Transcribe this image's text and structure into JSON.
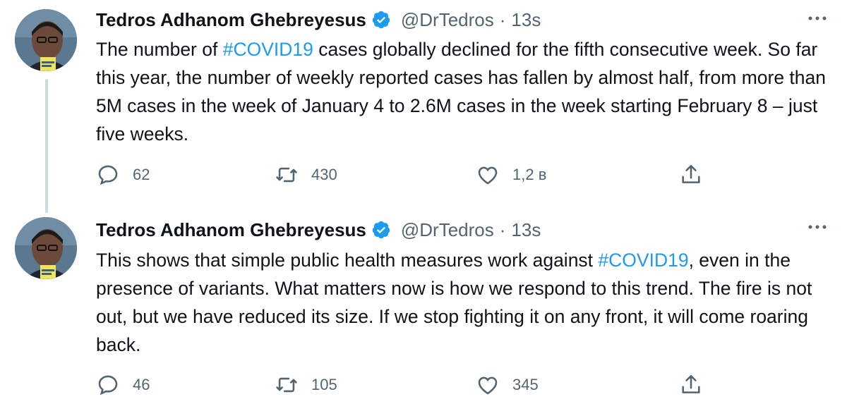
{
  "tweets": [
    {
      "author_name": "Tedros Adhanom Ghebreyesus",
      "handle": "@DrTedros",
      "separator": "·",
      "time": "13s",
      "text_parts": {
        "p1": "The number of ",
        "hashtag": "#COVID19",
        "p2": " cases globally declined for the fifth consecutive week. So far this year, the number of weekly reported cases has fallen by almost half, from more than 5M cases in the week of January 4 to 2.6M cases in the week starting February 8 – just five weeks."
      },
      "replies": "62",
      "retweets": "430",
      "likes": "1,2 в",
      "icons": {
        "reply": "speech-bubble-icon",
        "retweet": "retweet-icon",
        "like": "heart-icon",
        "share": "share-icon",
        "more": "more-icon",
        "verified": "verified-badge-icon"
      }
    },
    {
      "author_name": "Tedros Adhanom Ghebreyesus",
      "handle": "@DrTedros",
      "separator": "·",
      "time": "13s",
      "text_parts": {
        "p1": "This shows that simple public health measures work against ",
        "hashtag": "#COVID19",
        "p2": ", even in the presence of variants. What matters now is how we respond to this trend. The fire is not out, but we have reduced its size. If we stop fighting it on any front, it will come roaring back."
      },
      "replies": "46",
      "retweets": "105",
      "likes": "345",
      "icons": {
        "reply": "speech-bubble-icon",
        "retweet": "retweet-icon",
        "like": "heart-icon",
        "share": "share-icon",
        "more": "more-icon",
        "verified": "verified-badge-icon"
      }
    }
  ],
  "colors": {
    "hashtag": "#1d9bf0",
    "verified": "#1d9bf0",
    "muted": "#536471",
    "text": "#0f1419",
    "thread_line": "#cfd9de"
  }
}
